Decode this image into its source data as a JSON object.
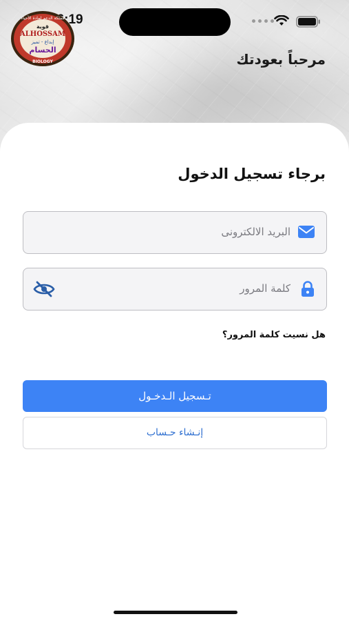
{
  "status_bar": {
    "time": "16:19"
  },
  "logo": {
    "lines": [
      "مملكة الدعم لمادة الأحياء",
      "قوية",
      "ALHOSSAM",
      "إبداع - تميز",
      "الحسام",
      "BIOLOGY"
    ]
  },
  "header": {
    "welcome": "مرحباً بعودتك"
  },
  "login": {
    "heading": "برجاء تسجيل الدخول",
    "email_placeholder": "البريد الالكترونى",
    "password_placeholder": "كلمة المرور",
    "forgot": "هل نسيت كلمة المرور؟",
    "login_button": "تـسجيل الـدخـول",
    "create_button": "إنـشاء حـساب"
  },
  "colors": {
    "primary": "#3d83f5",
    "link": "#2e6fd0",
    "field_bg": "#f4f4f6"
  },
  "icons": {
    "email": "envelope-icon",
    "password": "lock-icon",
    "toggle": "eye-off-icon"
  }
}
